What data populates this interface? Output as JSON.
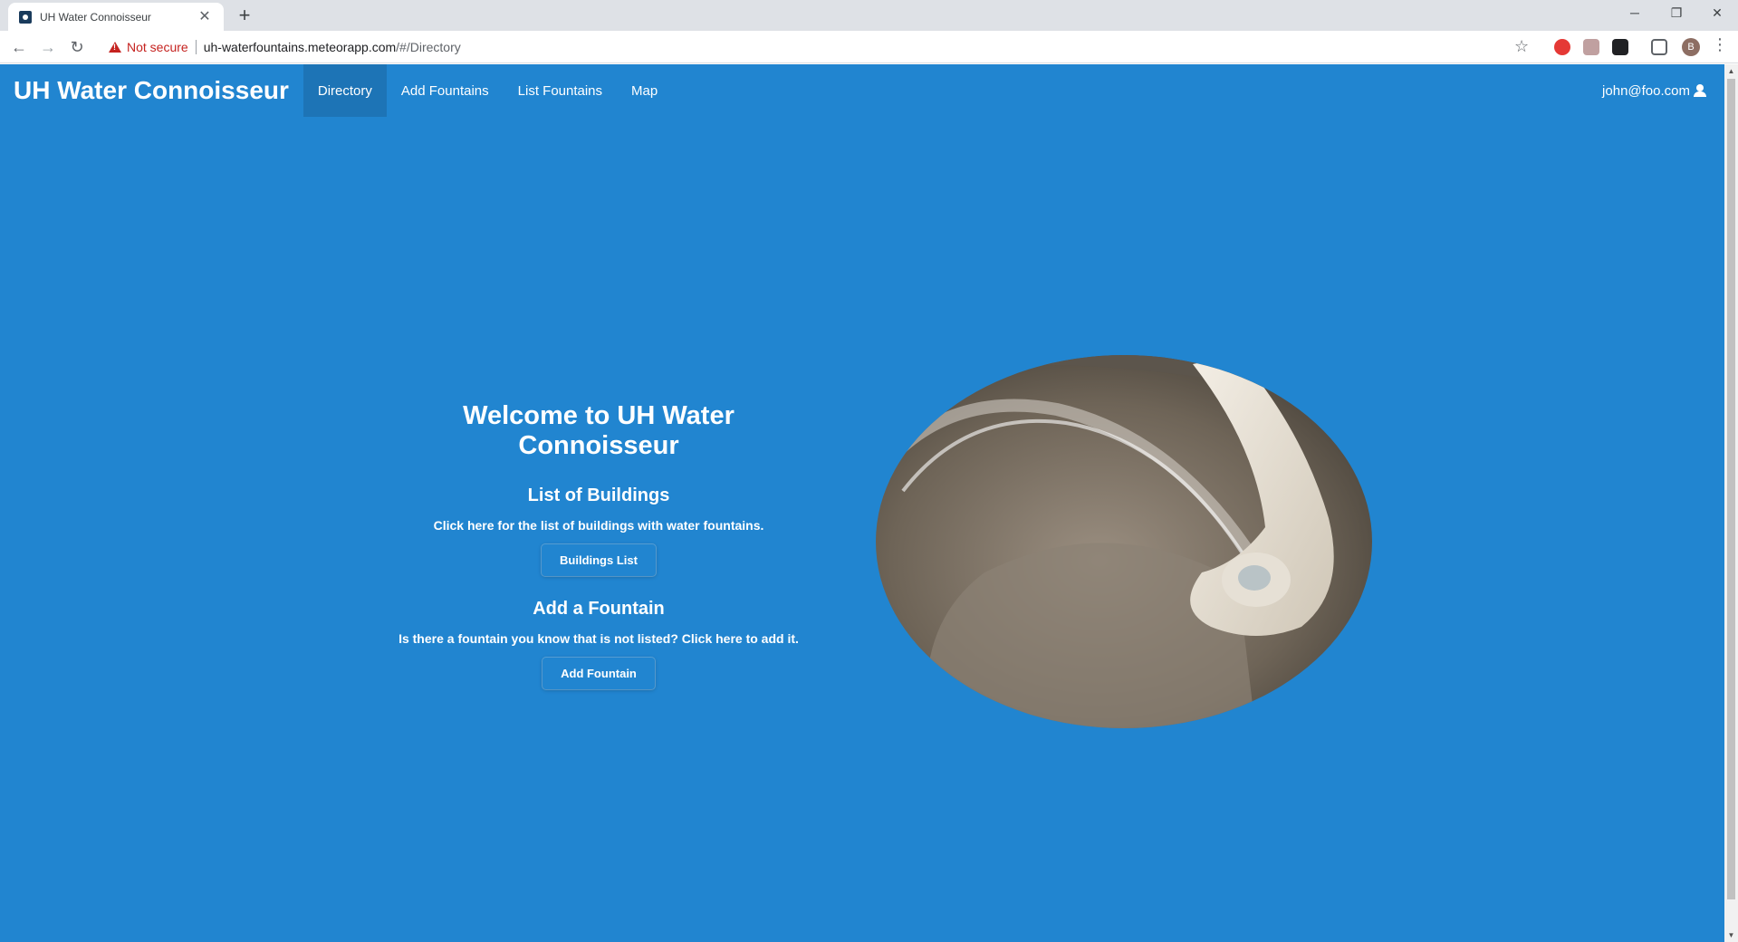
{
  "browser": {
    "tab_title": "UH Water Connoisseur",
    "security_label": "Not secure",
    "url_host": "uh-waterfountains.meteorapp.com",
    "url_path": "/#/Directory",
    "profile_initial": "B"
  },
  "navbar": {
    "brand": "UH Water Connoisseur",
    "items": [
      {
        "label": "Directory",
        "active": true
      },
      {
        "label": "Add Fountains",
        "active": false
      },
      {
        "label": "List Fountains",
        "active": false
      },
      {
        "label": "Map",
        "active": false
      }
    ],
    "user": "john@foo.com"
  },
  "main": {
    "title": "Welcome to UH Water Connoisseur",
    "buildings": {
      "heading": "List of Buildings",
      "text": "Click here for the list of buildings with water fountains.",
      "button": "Buildings List"
    },
    "fountain": {
      "heading": "Add a Fountain",
      "text": "Is there a fountain you know that is not listed? Click here to add it.",
      "button": "Add Fountain"
    }
  },
  "colors": {
    "page_background": "#2185d0",
    "text": "#ffffff"
  }
}
